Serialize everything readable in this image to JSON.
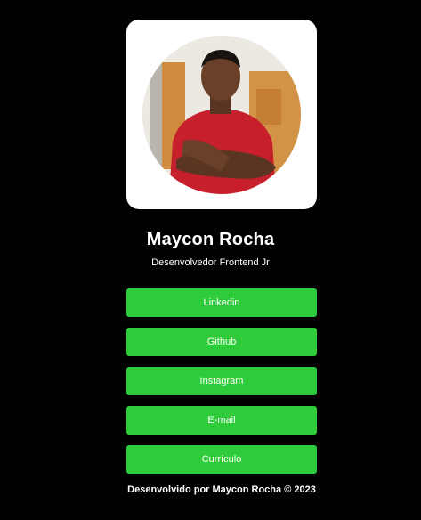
{
  "profile": {
    "name": "Maycon Rocha",
    "role": "Desenvolvedor Frontend Jr"
  },
  "links": [
    {
      "label": "Linkedin"
    },
    {
      "label": "Github"
    },
    {
      "label": "Instagram"
    },
    {
      "label": "E-mail"
    },
    {
      "label": "Currículo"
    }
  ],
  "footer": {
    "text": "Desenvolvido por Maycon Rocha © 2023"
  },
  "colors": {
    "background": "#000000",
    "button": "#2ecc3a",
    "card": "#ffffff",
    "text": "#ffffff"
  }
}
